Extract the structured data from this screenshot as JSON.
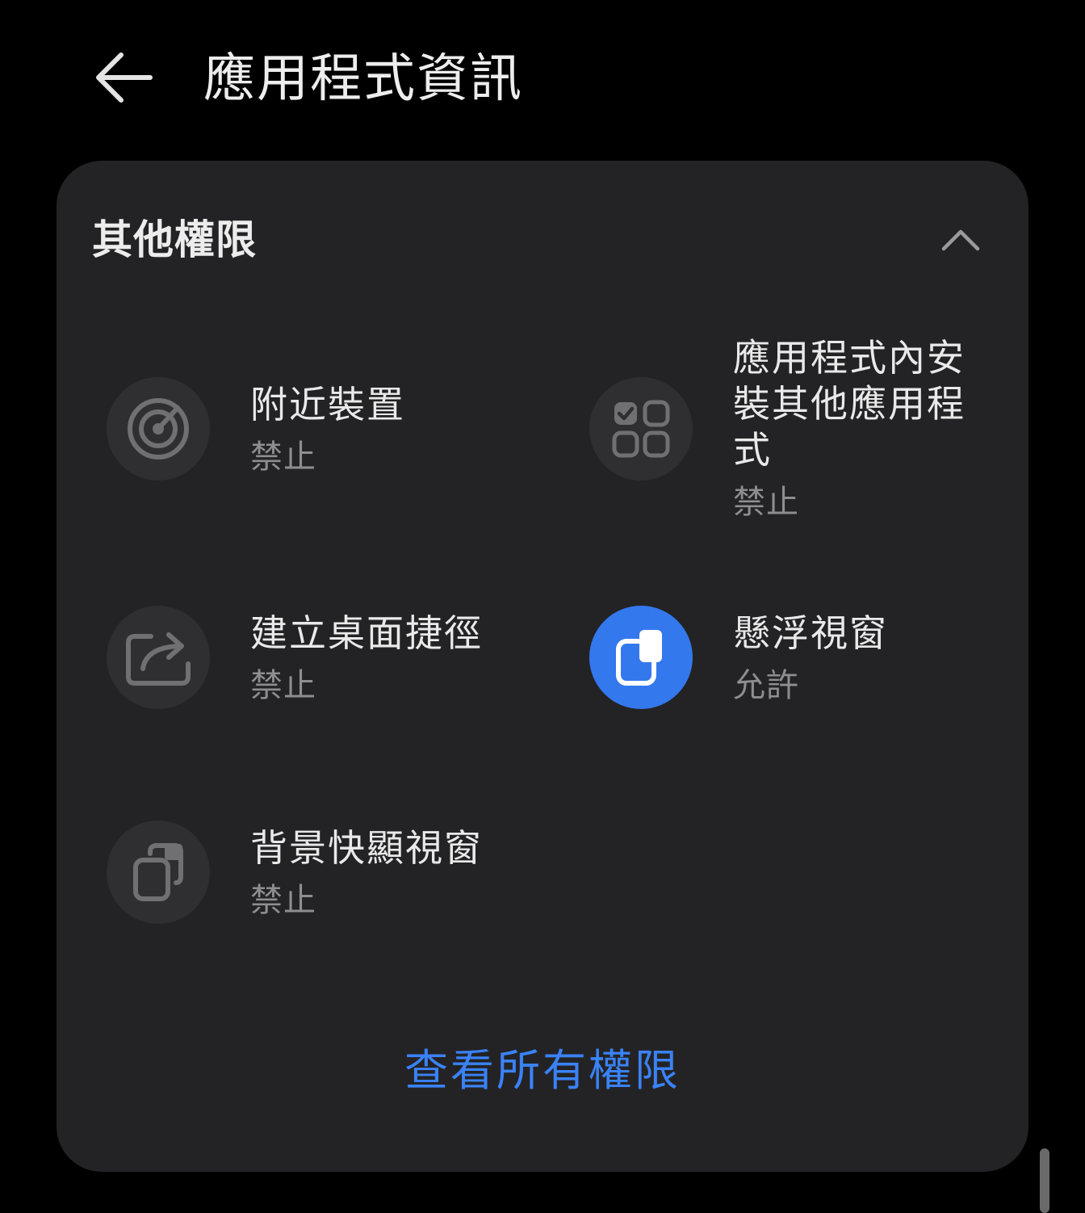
{
  "header": {
    "title": "應用程式資訊",
    "back_icon": "arrow-left-icon"
  },
  "section": {
    "title": "其他權限",
    "collapse_icon": "chevron-up-icon",
    "permissions": [
      {
        "label": "附近裝置",
        "status": "禁止",
        "icon": "radar-icon",
        "active": false
      },
      {
        "label": "應用程式內安裝其他應用程式",
        "status": "禁止",
        "icon": "app-grid-check-icon",
        "active": false
      },
      {
        "label": "建立桌面捷徑",
        "status": "禁止",
        "icon": "share-shortcut-icon",
        "active": false
      },
      {
        "label": "懸浮視窗",
        "status": "允許",
        "icon": "floating-window-icon",
        "active": true
      },
      {
        "label": "背景快顯視窗",
        "status": "禁止",
        "icon": "popup-window-icon",
        "active": false
      }
    ],
    "view_all_label": "查看所有權限"
  },
  "colors": {
    "background": "#000000",
    "card": "#232325",
    "icon_bg": "#2f2f31",
    "accent": "#3478ee",
    "link": "#3a82f6",
    "secondary_text": "#8e8e90"
  }
}
